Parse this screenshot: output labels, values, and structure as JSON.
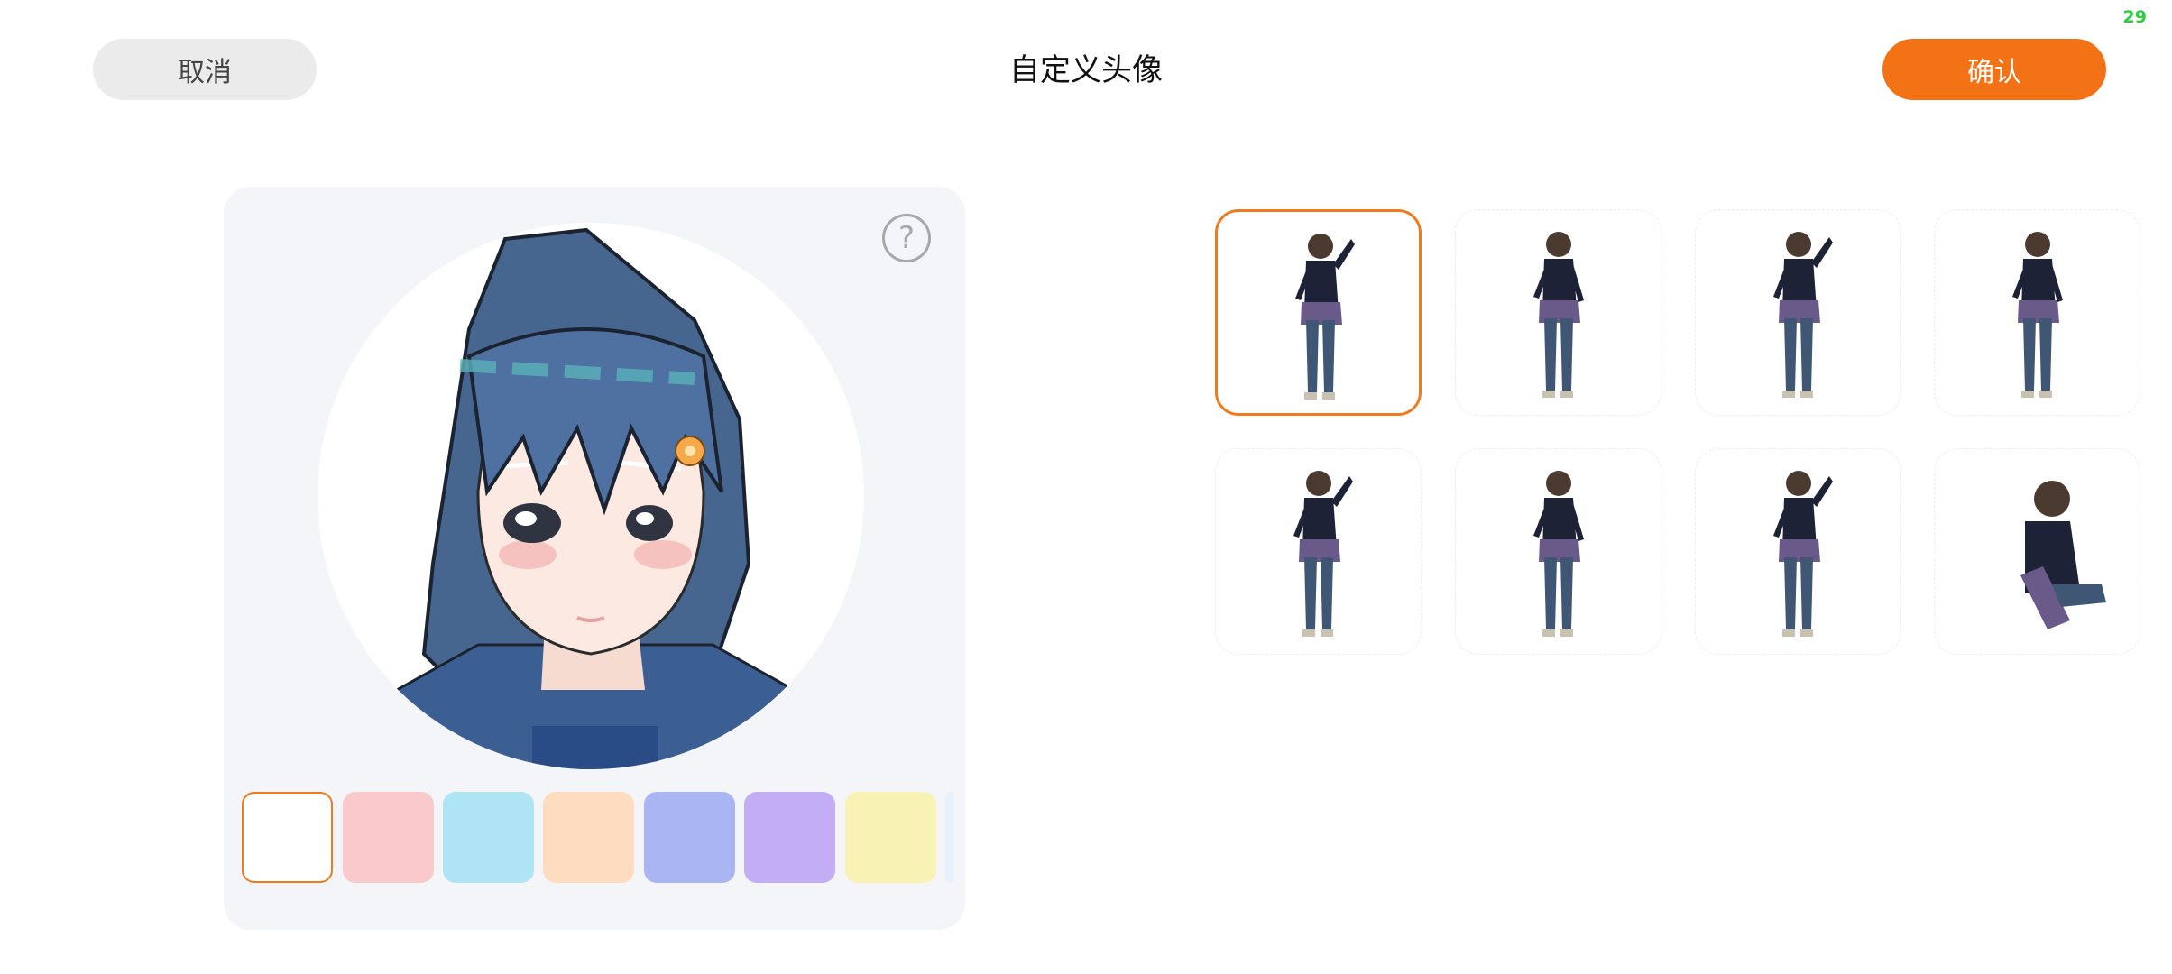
{
  "status": {
    "fps": "29"
  },
  "header": {
    "cancel_label": "取消",
    "title": "自定义头像",
    "confirm_label": "确认"
  },
  "preview": {
    "help_symbol": "?",
    "help_icon": "question-circle-icon",
    "avatar_icon": "anime-girl-portrait"
  },
  "background_colors": {
    "selected_index": 0,
    "swatches": [
      "#ffffff",
      "#f9c9cc",
      "#aee4f4",
      "#fddcbf",
      "#aab6f4",
      "#c3adf4",
      "#f8f3b5"
    ]
  },
  "poses": {
    "selected_index": 0,
    "items": [
      "pose-1",
      "pose-2",
      "pose-3",
      "pose-4",
      "pose-5",
      "pose-6",
      "pose-7",
      "pose-8"
    ]
  },
  "colors": {
    "accent": "#f47216",
    "cancel_bg": "#ebebeb",
    "panel_bg": "#f4f5f9"
  }
}
